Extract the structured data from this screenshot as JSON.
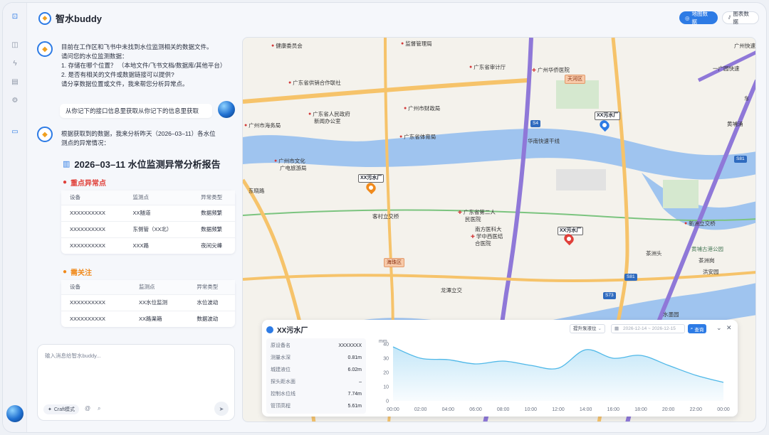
{
  "app": {
    "name": "智水buddy",
    "header_buttons": [
      {
        "label": "地图数据",
        "icon": "map-icon",
        "active": true
      },
      {
        "label": "图表数据",
        "icon": "chart-icon",
        "active": false
      }
    ]
  },
  "rail": {
    "items": [
      {
        "name": "sidebar-toggle-icon",
        "glyph": "⊡"
      },
      {
        "name": "chat-icon",
        "glyph": "◫"
      },
      {
        "name": "bolt-icon",
        "glyph": "ϟ"
      },
      {
        "name": "document-icon",
        "glyph": "▤"
      },
      {
        "name": "gear-icon",
        "glyph": "⚙"
      },
      {
        "name": "message-icon",
        "glyph": "▭"
      }
    ]
  },
  "chat": {
    "bot_message_1": [
      "目前在工作区和飞书中未找到水位监测相关的数据文件。",
      "请问您的水位监测数据：",
      "1. 存储在哪个位置？ （本地文件/飞书文档/数据库/其他平台）",
      "2. 是否有相关的文件或数据链接可以提供?",
      "请分享数据位置或文件，我来帮您分析异常点。"
    ],
    "user_message": "从你记下的接口信息里获取从你记下的信息里获取",
    "bot_message_2": [
      "根据获取到的数据，我来分析昨天（2026–03–11）各水位",
      "测点的异常情况："
    ],
    "report_title": "2026–03–11 水位监测异常分析报告",
    "key_anomalies": {
      "title": "重点异常点",
      "headers": [
        "设备",
        "监测点",
        "异常类型"
      ],
      "rows": [
        [
          "XXXXXXXXXX",
          "XX隧道",
          "数据频繁"
        ],
        [
          "XXXXXXXXXX",
          "东侧管（XX北）",
          "数据频繁"
        ],
        [
          "XXXXXXXXXX",
          "XXX路",
          "夜间尖峰"
        ]
      ]
    },
    "attention": {
      "title": "需关注",
      "headers": [
        "设备",
        "监测点",
        "异常类型"
      ],
      "rows": [
        [
          "XXXXXXXXXX",
          "XX水位监测",
          "水位波动"
        ],
        [
          "XXXXXXXXXX",
          "XX路渠箱",
          "数据波动"
        ]
      ]
    },
    "input": {
      "placeholder": "输入消息给智水buddy...",
      "craft_label": "Craft模式"
    }
  },
  "map": {
    "pois": [
      {
        "text": "健康委员会",
        "red": true
      },
      {
        "text": "监督管理局",
        "red": true
      },
      {
        "text": "广东省审计厅",
        "red": true
      },
      {
        "text": "广州华侨医院",
        "red": true
      },
      {
        "text": "广东省供销合作联社",
        "red": true
      },
      {
        "text": "广州市财政局",
        "red": true
      },
      {
        "text": "广东省人民政府",
        "red": true
      },
      {
        "text": "新闻办公室",
        "red": false
      },
      {
        "text": "广州市海务局",
        "red": true
      },
      {
        "text": "广东省体育局",
        "red": true
      },
      {
        "text": "广州市文化",
        "red": true
      },
      {
        "text": "广电旅游局",
        "red": false
      },
      {
        "text": "客村立交桥",
        "red": false
      },
      {
        "text": "广东省第二人",
        "red": true
      },
      {
        "text": "民医院",
        "red": false
      },
      {
        "text": "南方医科大",
        "red": true
      },
      {
        "text": "学中西医结",
        "red": false
      },
      {
        "text": "合医院",
        "red": false
      },
      {
        "text": "龙潭立交",
        "red": false
      },
      {
        "text": "新洲立交桥",
        "red": false
      },
      {
        "text": "黄埔古港公园",
        "red": false
      },
      {
        "text": "茶洲头",
        "red": false
      },
      {
        "text": "茶洲岗",
        "red": false
      },
      {
        "text": "洪安园",
        "red": false
      },
      {
        "text": "水墨园",
        "red": false
      },
      {
        "text": "广州快速",
        "red": false
      },
      {
        "text": "东晓路",
        "red": false
      },
      {
        "text": "海珠区",
        "red": false
      },
      {
        "text": "天河区",
        "red": false
      },
      {
        "text": "华南快速干线",
        "red": false
      },
      {
        "text": "一广园快速",
        "red": false
      },
      {
        "text": "黄埔涌",
        "red": false
      },
      {
        "text": "车",
        "red": false
      }
    ],
    "road_badges": [
      "S4",
      "S81",
      "S81",
      "S73"
    ],
    "pins": [
      {
        "label": "XX污水厂",
        "color": "#2d7be5"
      },
      {
        "label": "XX污水厂",
        "color": "#f08a1c"
      },
      {
        "label": "XX污水厂",
        "color": "#e0403a"
      }
    ]
  },
  "panel": {
    "title": "XX污水厂",
    "select_value": "提升泵液位",
    "date_placeholder": "2026-12-14 ~ 2026-12-15",
    "query_label": "查询",
    "info": [
      {
        "k": "原设备名",
        "v": "XXXXXXX"
      },
      {
        "k": "测量水深",
        "v": "0.81m"
      },
      {
        "k": "城建液位",
        "v": "6.02m"
      },
      {
        "k": "探头距水面",
        "v": "–"
      },
      {
        "k": "控制水位线",
        "v": "7.74m"
      },
      {
        "k": "管顶高程",
        "v": "5.61m"
      }
    ]
  },
  "chart_data": {
    "type": "area",
    "ylabel": "mm",
    "ylim": [
      0,
      40
    ],
    "yticks": [
      0,
      10,
      20,
      30,
      40
    ],
    "x": [
      "00:00",
      "02:00",
      "04:00",
      "06:00",
      "08:00",
      "10:00",
      "12:00",
      "14:00",
      "16:00",
      "18:00",
      "20:00",
      "22:00",
      "00:00"
    ],
    "x_points": [
      0,
      1,
      2,
      3,
      4,
      5,
      6,
      7,
      8,
      9,
      10,
      11,
      12
    ],
    "series": [
      {
        "values": [
          38,
          30,
          29,
          26,
          28,
          25,
          23,
          36,
          30,
          32,
          25,
          18,
          13
        ],
        "color": "#4fb8e8"
      }
    ],
    "grid": false
  }
}
